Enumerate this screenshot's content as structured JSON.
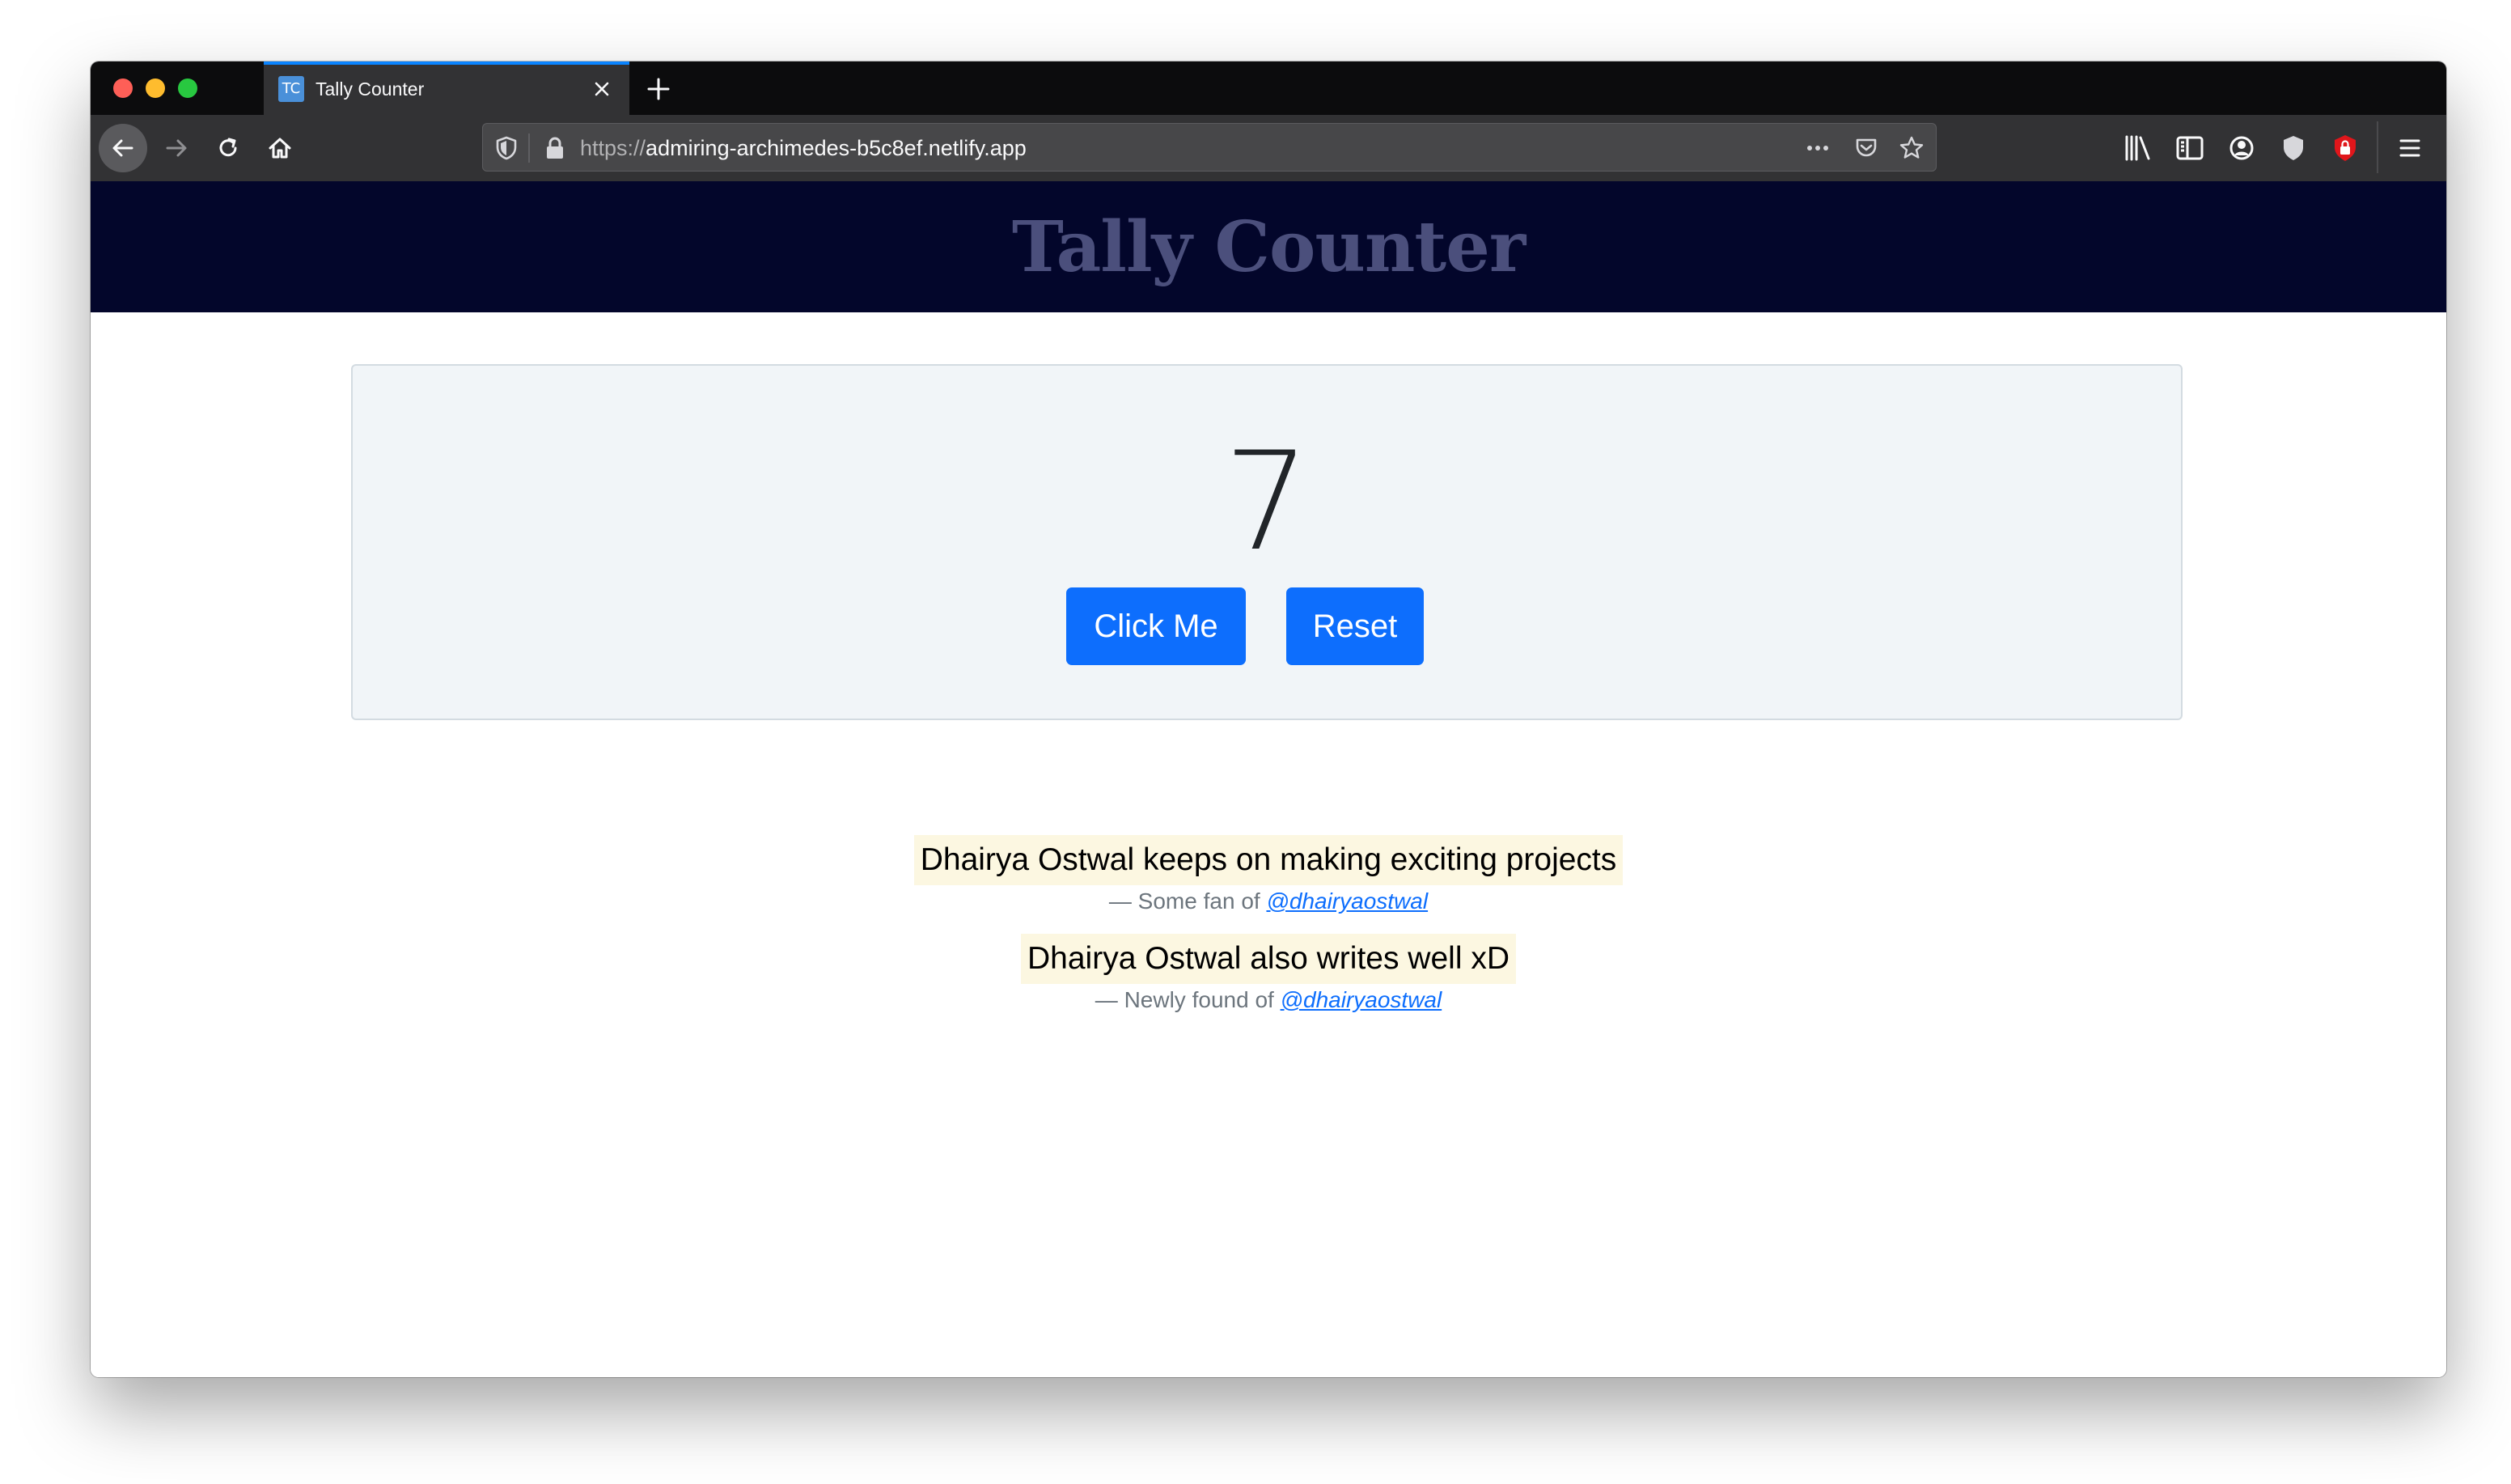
{
  "browser": {
    "tab": {
      "favicon_text": "TC",
      "title": "Tally Counter"
    },
    "url": {
      "scheme": "https://",
      "host": "admiring-archimedes-b5c8ef.netlify.app"
    },
    "icons": {
      "window_controls": [
        "close-dot",
        "minimize-dot",
        "zoom-dot"
      ],
      "nav": [
        "back-arrow-icon",
        "forward-arrow-icon",
        "reload-icon",
        "home-icon"
      ],
      "urlbar": [
        "tracking-shield-icon",
        "lock-icon",
        "more-actions-icon",
        "pocket-icon",
        "bookmark-star-icon"
      ],
      "toolbar_right": [
        "library-icon",
        "sidebar-icon",
        "account-icon",
        "shield-icon",
        "extension-lock-icon",
        "hamburger-menu-icon"
      ]
    }
  },
  "page": {
    "header_title": "Tally Counter",
    "counter": {
      "value": "7",
      "click_button": "Click Me",
      "reset_button": "Reset"
    },
    "quotes": [
      {
        "text": "Dhairya Ostwal keeps on making exciting projects",
        "cite_prefix": "— Some fan of ",
        "cite_handle": "@dhairyaostwal"
      },
      {
        "text": "Dhairya Ostwal also writes well xD",
        "cite_prefix": "— Newly found of ",
        "cite_handle": "@dhairyaostwal"
      }
    ]
  },
  "colors": {
    "header_bg": "#03062b",
    "header_title": "#4b4f7c",
    "card_bg": "#f1f5f8",
    "button": "#0d6efd",
    "quote_highlight": "#fcf7e1"
  }
}
